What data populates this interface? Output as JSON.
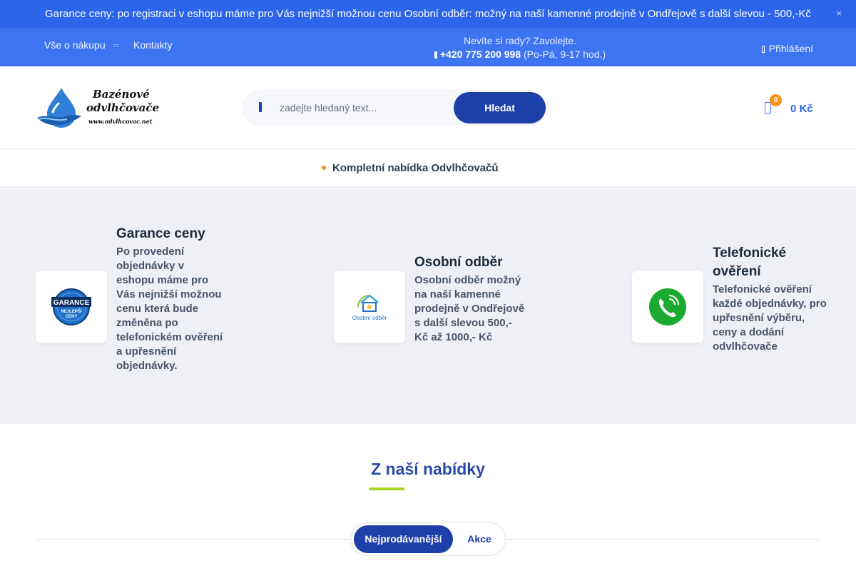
{
  "promo": {
    "text": "Garance ceny: po registraci v eshopu máme pro Vás nejnižší možnou cenu Osobní odběr: možný na naší kamenné prodejně v Ondřejově s další slevou - 500,-Kč",
    "close_icon": "×"
  },
  "topnav": {
    "shop_label": "Vše o nákupu",
    "contacts_label": "Kontakty",
    "help_question": "Nevíte si rady? Zavolejte.",
    "phone": "+420 775 200 998",
    "hours": "(Po-Pá, 9-17 hod.)",
    "login_label": "Přihlášení"
  },
  "header": {
    "logo_line1": "Bazénové",
    "logo_line2": "odvlhčovače",
    "logo_url": "www.odvlhcovac.net",
    "search_placeholder": "zadejte hledaný text...",
    "search_button": "Hledat",
    "cart_count": "0",
    "cart_total": "0 Kč"
  },
  "catnav": {
    "item": "Kompletní nabídka Odvlhčovačů"
  },
  "benefits": [
    {
      "title": "Garance ceny",
      "text": "Po provedení objednávky v eshopu máme pro Vás nejnižší možnou cenu která bude změněna po telefonickém ověření a upřesnění objednávky.",
      "badge_line1": "GARANCE",
      "badge_line2": "NEJLEPŠÍ",
      "badge_line3": "CENY"
    },
    {
      "title": "Osobní odběr",
      "text": "Osobní odběr možný na naší kamenné prodejně v Ondřejově s další slevou 500,-Kč až 1000,- Kč",
      "icon_label": "Osobní odběr"
    },
    {
      "title": "Telefonické ověření",
      "text": "Telefonické ověření každé objednávky, pro upřesnění výběru, ceny a dodání odvlhčovače"
    }
  ],
  "offer": {
    "title": "Z naší nabídky",
    "tabs": [
      "Nejprodávanější",
      "Akce"
    ]
  },
  "colors": {
    "promo_bg": "#2b65ea",
    "nav_bg": "#3d74f2",
    "primary_button": "#1d3fa8",
    "badge_orange": "#f7931e",
    "accent_green": "#a5d320"
  }
}
